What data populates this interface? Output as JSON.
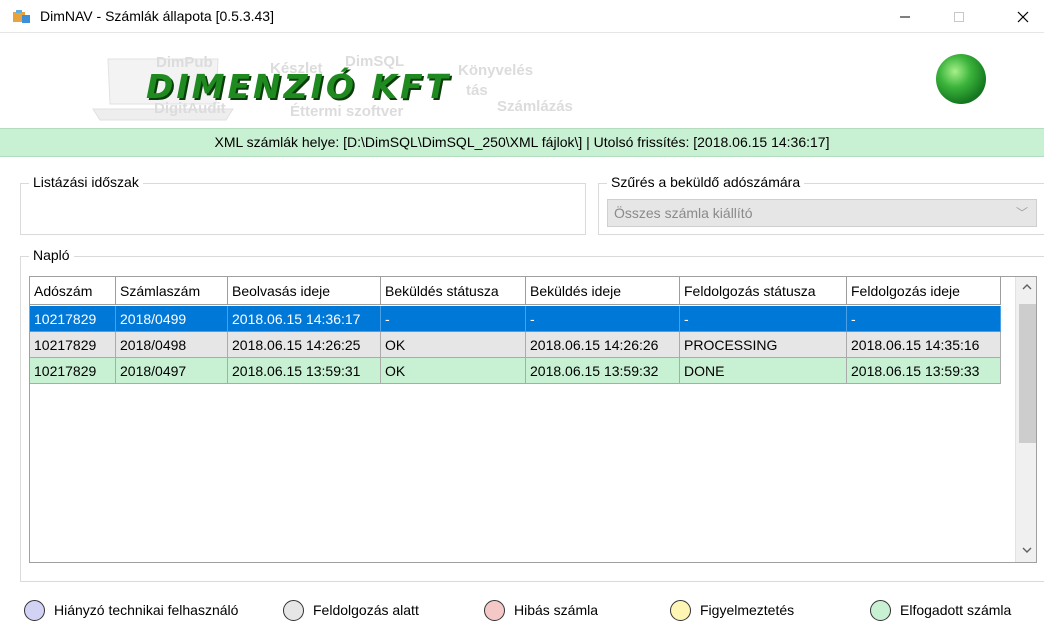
{
  "window": {
    "title": "DimNAV - Számlák állapota [0.5.3.43]",
    "controls": {
      "minimize": "—",
      "maximize": "☐",
      "close": "✕"
    }
  },
  "banner": {
    "logo_text": "DIMENZIÓ KFT",
    "background_words": [
      "DimPub",
      "Készlet",
      "DimSQL",
      "Könyvelés",
      "DigitAudit",
      "Éttermi szoftver",
      "Számlázás",
      "tás"
    ]
  },
  "status_bar": {
    "text": "XML számlák helye: [D:\\DimSQL\\DimSQL_250\\XML fájlok\\] | Utolsó frissítés: [2018.06.15 14:36:17]"
  },
  "period_group": {
    "label": "Listázási időszak"
  },
  "filter_group": {
    "label": "Szűrés a beküldő adószámára",
    "selected": "Összes számla kiállító"
  },
  "log_group": {
    "label": "Napló",
    "columns": [
      "Adószám",
      "Számlaszám",
      "Beolvasás ideje",
      "Beküldés státusza",
      "Beküldés ideje",
      "Feldolgozás státusza",
      "Feldolgozás ideje"
    ],
    "rows": [
      {
        "state": "selected",
        "cells": [
          "10217829",
          "2018/0499",
          "2018.06.15 14:36:17",
          "-",
          "-",
          "-",
          "-"
        ]
      },
      {
        "state": "processing",
        "cells": [
          "10217829",
          "2018/0498",
          "2018.06.15 14:26:25",
          "OK",
          "2018.06.15 14:26:26",
          "PROCESSING",
          "2018.06.15 14:35:16"
        ]
      },
      {
        "state": "done",
        "cells": [
          "10217829",
          "2018/0497",
          "2018.06.15 13:59:31",
          "OK",
          "2018.06.15 13:59:32",
          "DONE",
          "2018.06.15 13:59:33"
        ]
      }
    ]
  },
  "legend": [
    {
      "label": "Hiányzó technikai felhasználó",
      "color": "#d2d2f5"
    },
    {
      "label": "Feldolgozás alatt",
      "color": "#e6e6e6"
    },
    {
      "label": "Hibás számla",
      "color": "#f5c8c8"
    },
    {
      "label": "Figyelmeztetés",
      "color": "#fff5b4"
    },
    {
      "label": "Elfogadott számla",
      "color": "#c8f0d2"
    }
  ],
  "colors": {
    "selection": "#0078d7",
    "status_bar_bg": "#c8f0d2",
    "processing_row": "#e6e6e6",
    "done_row": "#c8f0d2",
    "logo_green": "#1f8a1f"
  }
}
